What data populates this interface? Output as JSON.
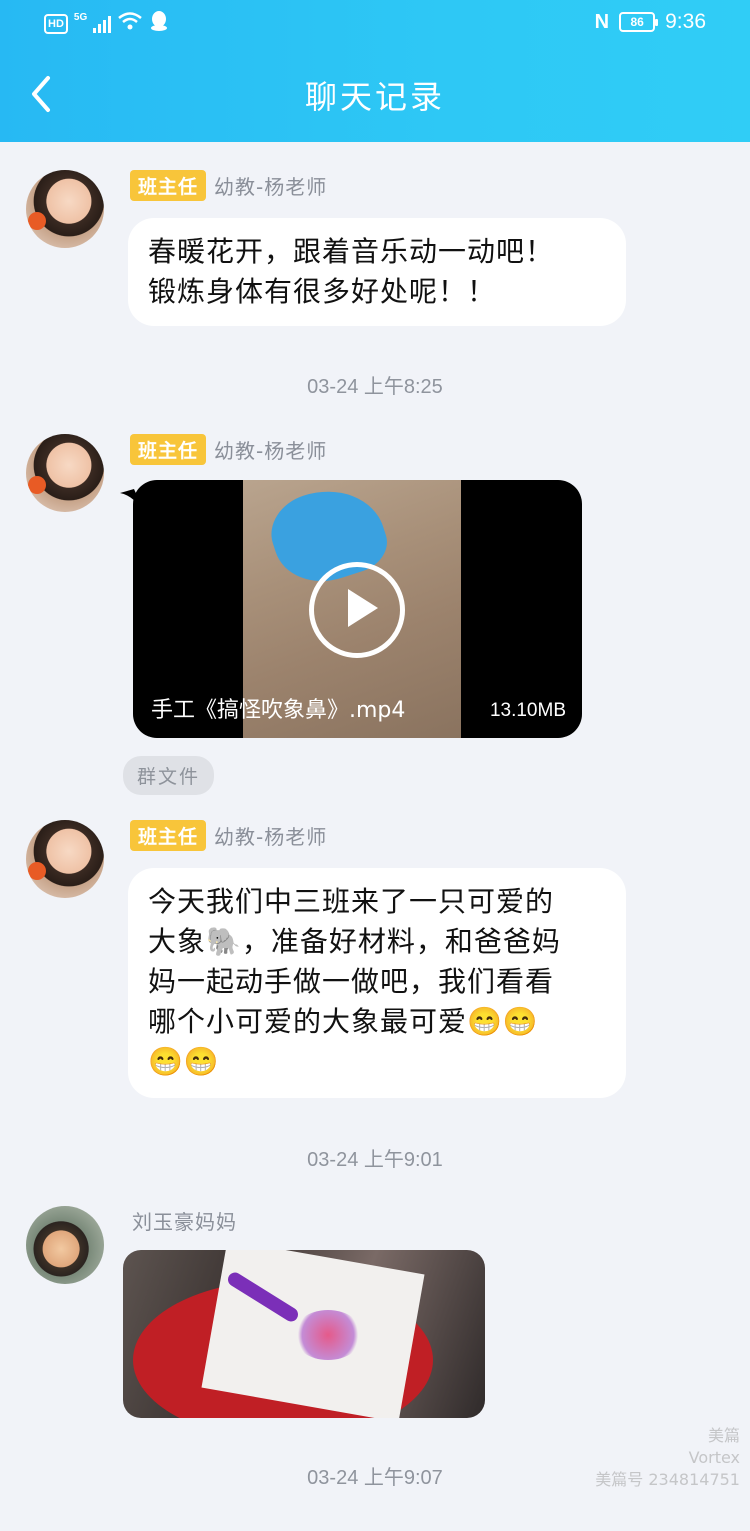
{
  "status_bar": {
    "hd": "HD",
    "network": "5G",
    "battery": "86",
    "nfc": "N",
    "time": "9:36"
  },
  "header": {
    "title": "聊天记录"
  },
  "messages": [
    {
      "role": "班主任",
      "sender": "幼教-杨老师",
      "lines": [
        "春暖花开，跟着音乐动一动吧！",
        "锻炼身体有很多好处呢！！"
      ]
    },
    {
      "timestamp": "03-24 上午8:25",
      "role": "班主任",
      "sender": "幼教-杨老师",
      "video_name": "手工《搞怪吹象鼻》.mp4",
      "video_size": "13.10MB",
      "file_tag": "群文件"
    },
    {
      "role": "班主任",
      "sender": "幼教-杨老师",
      "lines": [
        "今天我们中三班来了一只可爱的",
        "大象🐘，准备好材料，和爸爸妈",
        "妈一起动手做一做吧，我们看看",
        "哪个小可爱的大象最可爱😁😁",
        "😁😁"
      ]
    },
    {
      "timestamp": "03-24 上午9:01",
      "sender": "刘玉豪妈妈"
    },
    {
      "timestamp": "03-24 上午9:07"
    }
  ],
  "watermark": [
    "美篇",
    "Vortex",
    "美篇号 234814751"
  ],
  "colors": {
    "header_gradient_start": "#27b9f3",
    "header_gradient_end": "#30cdf6",
    "role_badge": "#f8c53a",
    "background": "#f1f3f8"
  }
}
